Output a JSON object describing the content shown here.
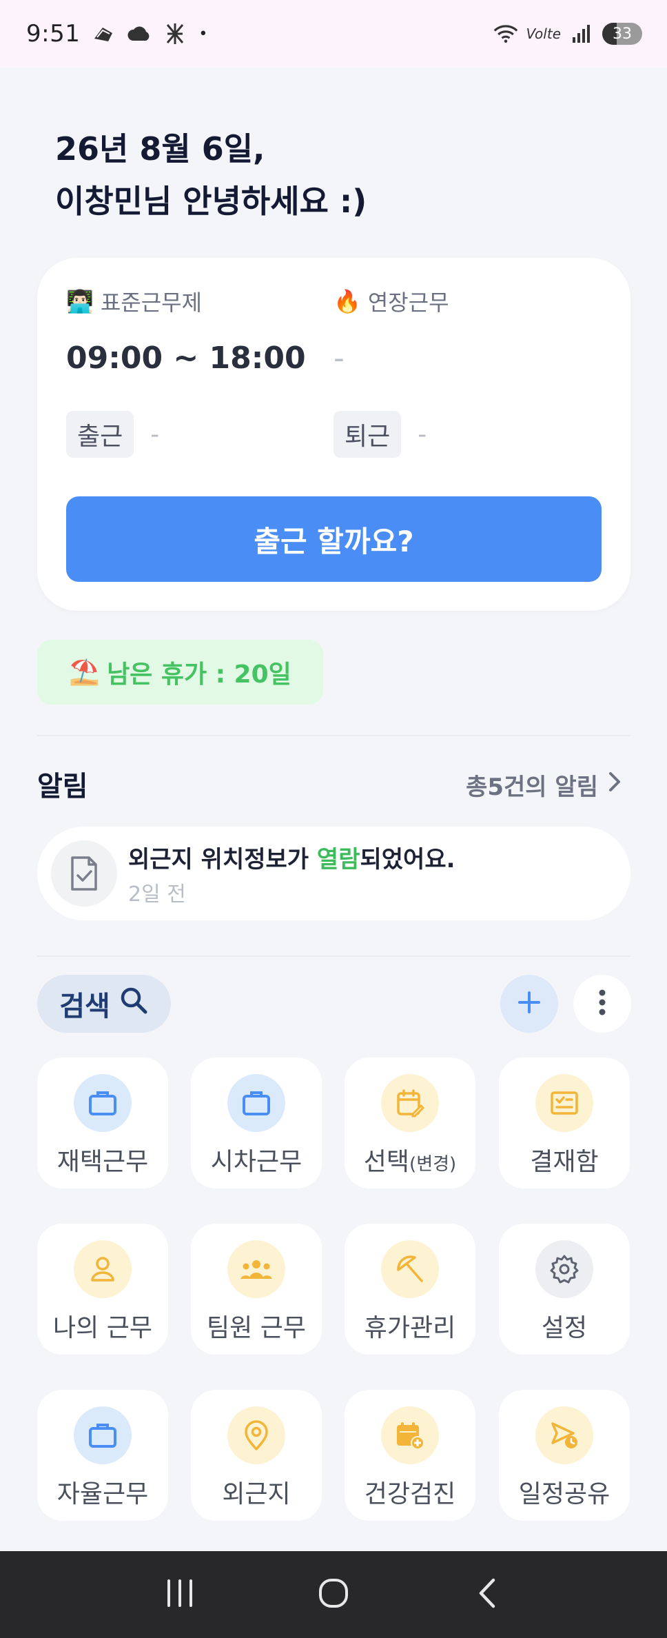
{
  "status_bar": {
    "time": "9:51",
    "dot": "•",
    "network": "Volte",
    "battery": "33",
    "icons": [
      "gallery-icon",
      "cloud-icon",
      "app-icon",
      "wifi-icon",
      "signal-icon",
      "battery-icon"
    ]
  },
  "greeting": {
    "line1": "26년 8월 6일,",
    "line2": "이창민님 안녕하세요 :)"
  },
  "work": {
    "type_emoji": "👨🏻‍💻",
    "type_label": "표준근무제",
    "hours": "09:00 ~ 18:00",
    "overtime_emoji": "🔥",
    "overtime_label": "연장근무",
    "overtime_value": "-",
    "clock_in_label": "출근",
    "clock_in_value": "-",
    "clock_out_label": "퇴근",
    "clock_out_value": "-",
    "button_label": "출근 할까요?"
  },
  "leave": {
    "emoji": "⛱️",
    "text": "남은 휴가 : 20일"
  },
  "notifications": {
    "title": "알림",
    "total": "총5건의 알림",
    "item": {
      "prefix": "외근지 위치정보가 ",
      "highlight": "열람",
      "suffix": "되었어요.",
      "time": "2일 전"
    }
  },
  "search": {
    "label": "검색"
  },
  "tiles": [
    {
      "label": "재택근무",
      "icon": "briefcase-icon",
      "color": "blue"
    },
    {
      "label": "시차근무",
      "icon": "briefcase-icon",
      "color": "blue"
    },
    {
      "label": "선택",
      "sub": "(변경)",
      "icon": "calendar-edit-icon",
      "color": "yellow"
    },
    {
      "label": "결재함",
      "icon": "approval-icon",
      "color": "yellow"
    },
    {
      "label": "나의 근무",
      "icon": "person-icon",
      "color": "yellow"
    },
    {
      "label": "팀원 근무",
      "icon": "team-icon",
      "color": "yellow"
    },
    {
      "label": "휴가관리",
      "icon": "umbrella-icon",
      "color": "yellow"
    },
    {
      "label": "설정",
      "icon": "gear-icon",
      "color": "gray"
    },
    {
      "label": "자율근무",
      "icon": "briefcase-icon",
      "color": "blue"
    },
    {
      "label": "외근지",
      "icon": "location-pin-icon",
      "color": "yellow"
    },
    {
      "label": "건강검진",
      "icon": "health-calendar-icon",
      "color": "yellow"
    },
    {
      "label": "일정공유",
      "icon": "share-schedule-icon",
      "color": "yellow"
    }
  ],
  "colors": {
    "primary": "#4a8ef5",
    "leave_green": "#45c261",
    "highlight_green": "#3dbb5a",
    "icon_blue": "#4a8ef5",
    "icon_yellow": "#f2b53a"
  }
}
